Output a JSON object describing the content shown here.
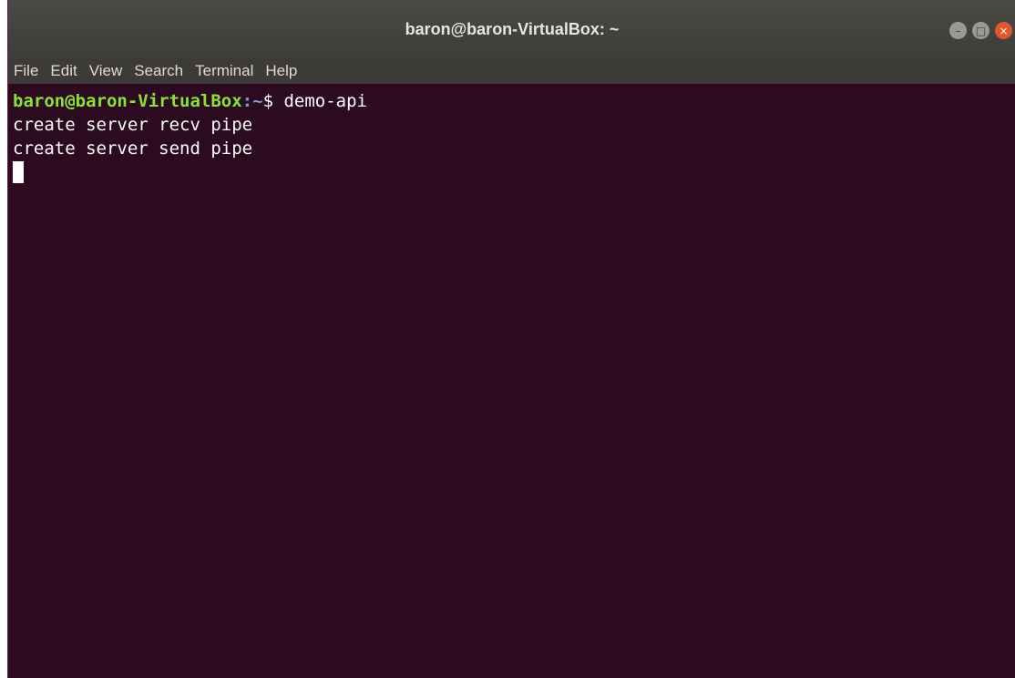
{
  "window": {
    "title": "baron@baron-VirtualBox: ~",
    "controls": {
      "minimize_icon": "minimize-icon",
      "maximize_icon": "maximize-icon",
      "close_icon": "close-icon",
      "minimize_glyph": "–",
      "maximize_glyph": "□",
      "close_glyph": "×"
    }
  },
  "menubar": {
    "items": [
      "File",
      "Edit",
      "View",
      "Search",
      "Terminal",
      "Help"
    ]
  },
  "terminal": {
    "prompt_user_host": "baron@baron-VirtualBox",
    "prompt_colon": ":",
    "prompt_path": "~",
    "prompt_symbol": "$ ",
    "command": "demo-api",
    "output": [
      "create server recv pipe",
      "create server send pipe"
    ]
  },
  "colors": {
    "terminal_bg": "#2c0a1f",
    "prompt_user": "#8ae234",
    "prompt_path": "#729fcf",
    "text": "#ffffff",
    "close_button": "#e2562c"
  }
}
